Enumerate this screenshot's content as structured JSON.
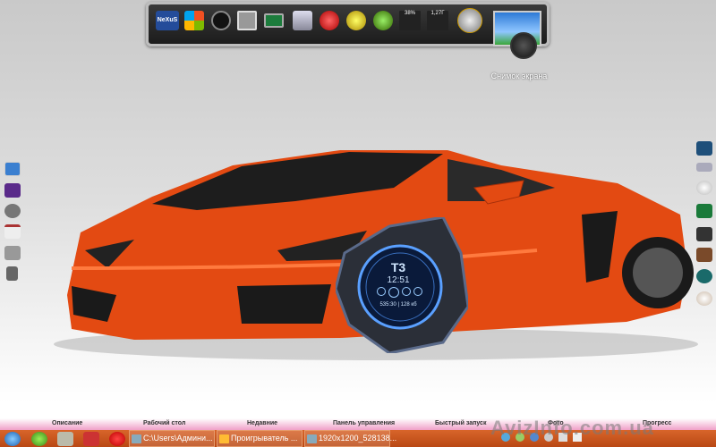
{
  "dock": {
    "icons": [
      "nexus-logo",
      "windows-flag",
      "clock",
      "photo-viewer",
      "monitor",
      "recycle-bin",
      "power-red",
      "power-yellow",
      "power-green",
      "cpu-meter",
      "network-meter",
      "globe-internet",
      "screenshot-camera"
    ],
    "cpu_percent": "38%",
    "net_value": "1,27Г",
    "logo_text": "NeXuS",
    "screenshot_label": "Снимок экрана"
  },
  "left_bar": [
    "monitor",
    "image-gallery",
    "settings",
    "home",
    "calculator",
    "trash"
  ],
  "right_bar": [
    "app",
    "gamepad",
    "cd-disc",
    "media-gallery",
    "video",
    "photos",
    "media-player",
    "dvd"
  ],
  "widget": {
    "logo": "T3",
    "time": "12:51",
    "status": "535:30 | 128 кб"
  },
  "taskbar": {
    "sections": [
      "Описание",
      "Рабочий стол",
      "Недавние",
      "Панель управления",
      "Быстрый запуск",
      "Фото",
      "Прогресс"
    ],
    "tasks": [
      "C:\\Users\\Админи...",
      "Проигрыватель ...",
      "1920x1200_528138..."
    ],
    "accent": "#c9541e"
  },
  "watermark": "AvizInfo.com.ua"
}
